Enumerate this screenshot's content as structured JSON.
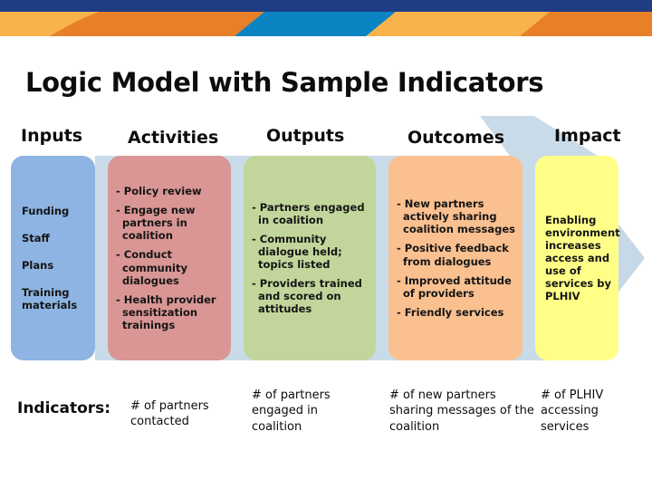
{
  "slide": {
    "title": "Logic Model with Sample Indicators"
  },
  "banner": {
    "colors": {
      "navy": "#1F3D85",
      "orange_dark": "#E8802A",
      "orange_light": "#F8B34C",
      "blue": "#0B84C4",
      "white": "#FFFFFF"
    }
  },
  "arrow": {
    "color": "#C6D9E8",
    "direction": "right"
  },
  "columns": [
    {
      "header": "Inputs",
      "color": "#8DB4E2",
      "items": [
        "Funding",
        "Staff",
        "Plans",
        "Training materials"
      ],
      "indicator": "# of partners contacted"
    },
    {
      "header": "Activities",
      "color": "#D99694",
      "items": [
        "- Policy review",
        "- Engage new partners in coalition",
        "- Conduct community dialogues",
        "- Health provider sensitization trainings"
      ],
      "indicator": "# of partners engaged in coalition"
    },
    {
      "header": "Outputs",
      "color": "#C2D69B",
      "items": [
        "- Partners engaged in coalition",
        "- Community dialogue held; topics listed",
        "- Providers trained and scored on attitudes"
      ],
      "indicator": "# of new partners sharing messages of the coalition"
    },
    {
      "header": "Outcomes",
      "color": "#FAC090",
      "items": [
        "- New partners actively sharing coalition messages",
        "- Positive feedback from dialogues",
        "- Improved attitude of providers",
        "- Friendly services"
      ],
      "indicator": "# of PLHIV accessing services"
    },
    {
      "header": "Impact",
      "color": "#FFFF88",
      "items": [
        "Enabling environment increases access and use of services by PLHIV"
      ],
      "indicator": ""
    }
  ],
  "indicators_row": {
    "label": "Indicators:",
    "values": [
      "# of partners contacted",
      "# of partners engaged in coalition",
      "# of new partners sharing messages of the coalition",
      "# of PLHIV accessing services"
    ]
  }
}
